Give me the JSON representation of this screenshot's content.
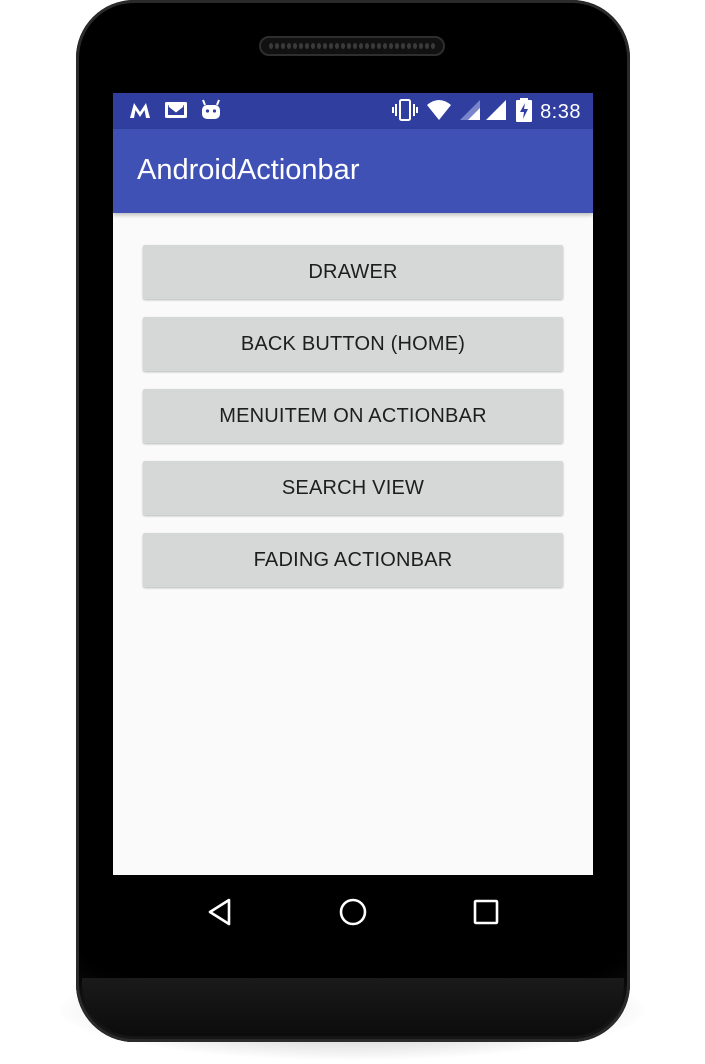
{
  "status_bar": {
    "time": "8:38",
    "notification_icons": [
      "gmail-m-icon",
      "mail-icon",
      "android-debug-icon"
    ],
    "system_icons": [
      "vibrate-icon",
      "wifi-icon",
      "signal-icon",
      "battery-charging-icon"
    ]
  },
  "app_bar": {
    "title": "AndroidActionbar"
  },
  "buttons": [
    {
      "label": "DRAWER"
    },
    {
      "label": "BACK BUTTON (HOME)"
    },
    {
      "label": "MENUITEM ON ACTIONBAR"
    },
    {
      "label": "SEARCH VIEW"
    },
    {
      "label": "FADING ACTIONBAR"
    }
  ],
  "nav_bar": {
    "icons": [
      "back-icon",
      "home-icon",
      "recents-icon"
    ]
  },
  "colors": {
    "status_bar": "#303f9f",
    "app_bar": "#3f51b5",
    "button_bg": "#d6d7d7",
    "screen_bg": "#fafafa"
  }
}
